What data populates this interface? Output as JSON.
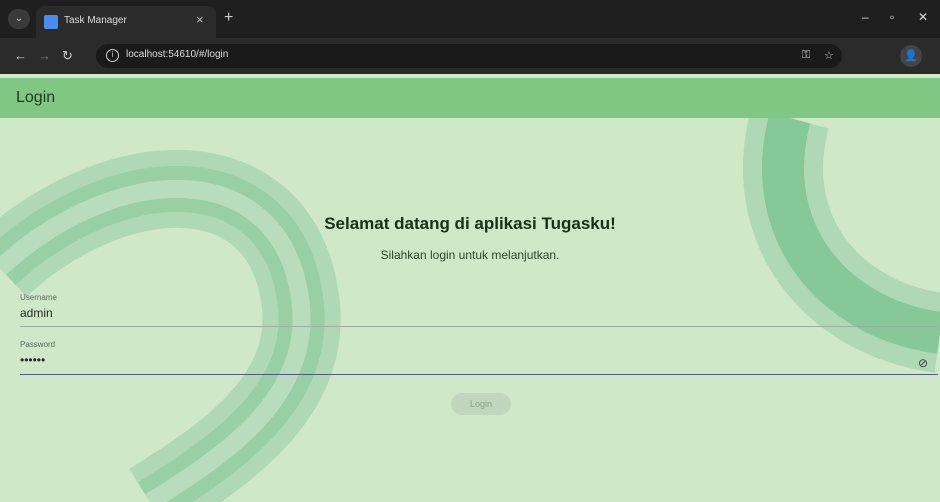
{
  "browser": {
    "tab_title": "Task Manager",
    "url": "localhost:54610/#/login",
    "tab_close": "×",
    "new_tab": "+",
    "window_controls": [
      "–",
      "▫",
      "✕"
    ]
  },
  "appbar": {
    "title": "Login"
  },
  "main": {
    "welcome": "Selamat datang di aplikasi Tugasku!",
    "subtitle": "Silahkan login untuk melanjutkan."
  },
  "form": {
    "username_label": "Username",
    "username_value": "admin",
    "password_label": "Password",
    "password_value": "••••••",
    "login_label": "Login"
  },
  "colors": {
    "appbar": "#81c784",
    "background": "#cfe8c8",
    "deco_stripes": [
      "#a9d6b0",
      "#93cca0",
      "#7cc391"
    ]
  },
  "icons": {
    "visibility_toggle": "eye-off-icon",
    "site_info": "info-icon"
  }
}
